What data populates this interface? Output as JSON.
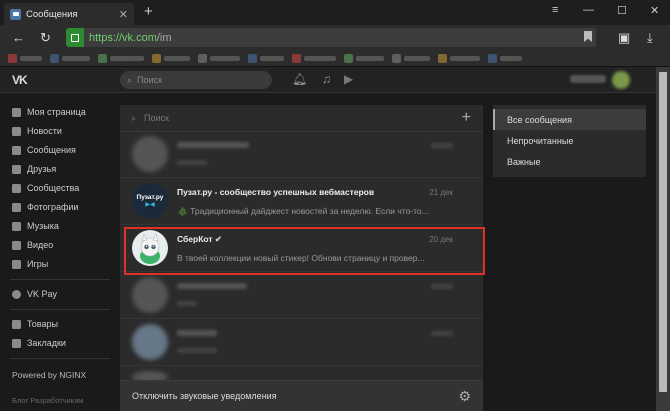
{
  "browser": {
    "tab_title": "Сообщения",
    "tab_close": "✕",
    "new_tab": "+",
    "url_scheme": "https://",
    "url_host": "vk.com",
    "url_path": "/im",
    "window": {
      "minimize": "—",
      "maximize": "☐",
      "close": "✕",
      "menu": "≡"
    }
  },
  "header": {
    "logo": "VK",
    "search_placeholder": "Поиск"
  },
  "left_menu": {
    "items": [
      {
        "label": "Моя страница",
        "icon": "home-icon"
      },
      {
        "label": "Новости",
        "icon": "news-icon"
      },
      {
        "label": "Сообщения",
        "icon": "messages-icon"
      },
      {
        "label": "Друзья",
        "icon": "friends-icon"
      },
      {
        "label": "Сообщества",
        "icon": "communities-icon"
      },
      {
        "label": "Фотографии",
        "icon": "photos-icon"
      },
      {
        "label": "Музыка",
        "icon": "music-icon"
      },
      {
        "label": "Видео",
        "icon": "video-icon"
      },
      {
        "label": "Игры",
        "icon": "games-icon"
      }
    ],
    "vkpay": "VK Pay",
    "extra": [
      {
        "label": "Товары",
        "icon": "goods-icon"
      },
      {
        "label": "Закладки",
        "icon": "bookmarks-icon"
      }
    ],
    "powered": "Powered by NGINX",
    "footer": "Блог  Разработчикам"
  },
  "dialogs": {
    "search_placeholder": "Поиск",
    "list": [
      {
        "name": "Пузат.ру - сообщество успешных вебмастеров",
        "date": "21 дек",
        "message": "Традиционный дайджест новостей за неделю. Если что-то..."
      },
      {
        "name": "СберКот",
        "date": "20 дек",
        "message": "В твоей коллекции новый стикер! Обнови страницу и провер..."
      }
    ],
    "avatar_text": "Пузат.ру",
    "footer_label": "Отключить звуковые уведомления"
  },
  "folders": {
    "items": [
      "Все сообщения",
      "Непрочитанные",
      "Важные"
    ],
    "active": 0
  },
  "colors": {
    "highlight": "#e0302a",
    "url_green": "#6fcf6f",
    "lock_green": "#2e8b34"
  }
}
